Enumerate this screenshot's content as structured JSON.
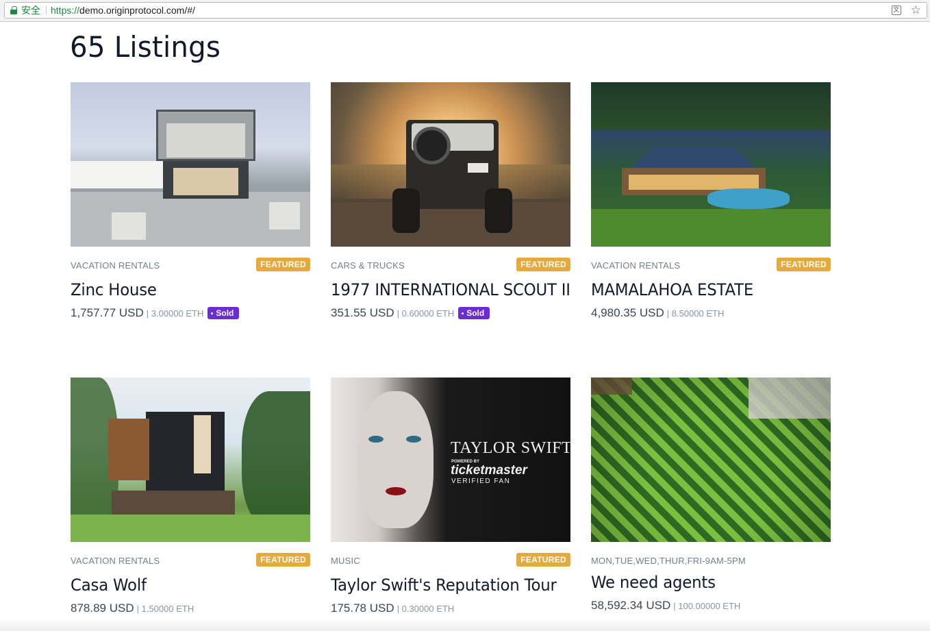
{
  "browser": {
    "secure_label": "安全",
    "url_scheme": "https://",
    "url_rest": "demo.originprotocol.com/#/",
    "translate_icon": "translate-icon",
    "bookmark_icon": "star-icon"
  },
  "page": {
    "title": "65 Listings"
  },
  "colors": {
    "featured": "#e5a93c",
    "sold": "#6c2cd4",
    "secure": "#1b8a3a"
  },
  "listings": [
    {
      "category": "VACATION RENTALS",
      "featured": "FEATURED",
      "title": "Zinc House",
      "price_usd": "1,757.77 USD",
      "price_eth": "| 3.00000 ETH",
      "sold": "Sold"
    },
    {
      "category": "CARS & TRUCKS",
      "featured": "FEATURED",
      "title": "1977 INTERNATIONAL SCOUT II",
      "price_usd": "351.55 USD",
      "price_eth": "| 0.60000 ETH",
      "sold": "Sold"
    },
    {
      "category": "VACATION RENTALS",
      "featured": "FEATURED",
      "title": "MAMALAHOA ESTATE",
      "price_usd": "4,980.35 USD",
      "price_eth": "| 8.50000 ETH"
    },
    {
      "category": "VACATION RENTALS",
      "featured": "FEATURED",
      "title": "Casa Wolf",
      "price_usd": "878.89 USD",
      "price_eth": "| 1.50000 ETH"
    },
    {
      "category": "MUSIC",
      "featured": "FEATURED",
      "title": "Taylor Swift's Reputation Tour",
      "price_usd": "175.78 USD",
      "price_eth": "| 0.30000 ETH",
      "image_text": {
        "headline": "TAYLOR SWIFT TD",
        "powered": "POWERED BY",
        "brand": "ticketmaster",
        "tagline": "VERIFIED FAN"
      }
    },
    {
      "category": "MON,TUE,WED,THUR,FRI-9AM-5PM",
      "title": "We need agents",
      "price_usd": "58,592.34 USD",
      "price_eth": "| 100.00000 ETH"
    }
  ]
}
